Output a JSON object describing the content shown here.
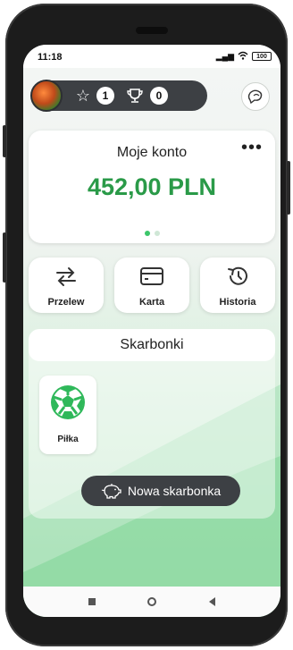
{
  "status_bar": {
    "time": "11:18",
    "signal": "4G",
    "battery": "100"
  },
  "header": {
    "stars_count": "1",
    "trophies_count": "0",
    "icons": {
      "star": "star-icon",
      "trophy": "trophy-icon",
      "chat": "chat-bubbles-icon"
    }
  },
  "account": {
    "title": "Moje konto",
    "balance": "452,00 PLN",
    "more": "•••",
    "page_count": 2,
    "active_page": 1
  },
  "actions": [
    {
      "label": "Przelew",
      "icon": "transfer-arrows-icon"
    },
    {
      "label": "Karta",
      "icon": "card-icon"
    },
    {
      "label": "Historia",
      "icon": "history-icon"
    }
  ],
  "savings": {
    "title": "Skarbonki",
    "goals": [
      {
        "label": "Piłka",
        "icon": "soccer-ball-icon"
      }
    ],
    "new_button_label": "Nowa skarbonka",
    "new_button_icon": "piggy-bank-icon"
  },
  "colors": {
    "accent_green": "#2a9a48",
    "dark_pill": "#3d4044"
  }
}
